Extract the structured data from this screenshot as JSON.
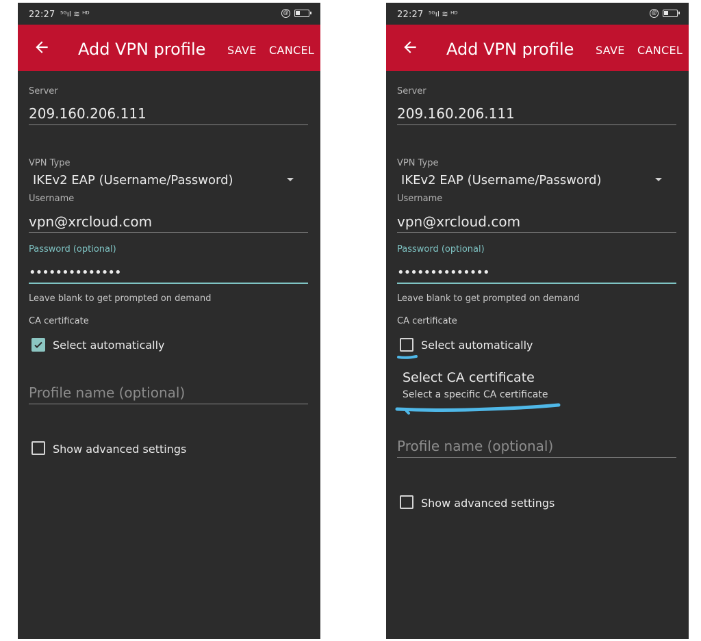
{
  "screens": [
    {
      "status": {
        "time": "22:27",
        "icons": "⁵ᴳıl ≋ ᴴᴰ",
        "lock": "@"
      },
      "app_bar": {
        "title": "Add VPN profile",
        "save_label": "SAVE",
        "cancel_label": "CANCEL"
      },
      "server": {
        "label": "Server",
        "value": "209.160.206.111"
      },
      "vpn_type": {
        "label": "VPN Type",
        "value": "IKEv2 EAP (Username/Password)"
      },
      "username": {
        "label": "Username",
        "value": "vpn@xrcloud.com"
      },
      "password": {
        "label": "Password (optional)",
        "value": "••••••••••••••",
        "hint": "Leave blank to get prompted on demand"
      },
      "ca_certificate": {
        "label": "CA certificate",
        "select_auto_label": "Select automatically",
        "select_auto_checked": true
      },
      "profile_name": {
        "placeholder": "Profile name (optional)"
      },
      "advanced": {
        "label": "Show advanced settings",
        "checked": false
      }
    },
    {
      "status": {
        "time": "22:27",
        "icons": "⁵ᴳıl ≋ ᴴᴰ",
        "lock": "@"
      },
      "app_bar": {
        "title": "Add VPN profile",
        "save_label": "SAVE",
        "cancel_label": "CANCEL"
      },
      "server": {
        "label": "Server",
        "value": "209.160.206.111"
      },
      "vpn_type": {
        "label": "VPN Type",
        "value": "IKEv2 EAP (Username/Password)"
      },
      "username": {
        "label": "Username",
        "value": "vpn@xrcloud.com"
      },
      "password": {
        "label": "Password (optional)",
        "value": "••••••••••••••",
        "hint": "Leave blank to get prompted on demand"
      },
      "ca_certificate": {
        "label": "CA certificate",
        "select_auto_label": "Select automatically",
        "select_auto_checked": false,
        "select_title": "Select CA certificate",
        "select_subtitle": "Select a specific CA certificate"
      },
      "profile_name": {
        "placeholder": "Profile name (optional)"
      },
      "advanced": {
        "label": "Show advanced settings",
        "checked": false
      }
    }
  ],
  "colors": {
    "app_bar": "#c0122e",
    "background": "#2c2c2c",
    "accent": "#7fc4c4",
    "annotation_highlight": "#4fb8e8"
  },
  "icons": {
    "back": "arrow-back-icon",
    "dropdown": "chevron-down-icon",
    "check": "checkmark-icon",
    "battery": "battery-icon",
    "lock": "rotation-lock-icon"
  }
}
